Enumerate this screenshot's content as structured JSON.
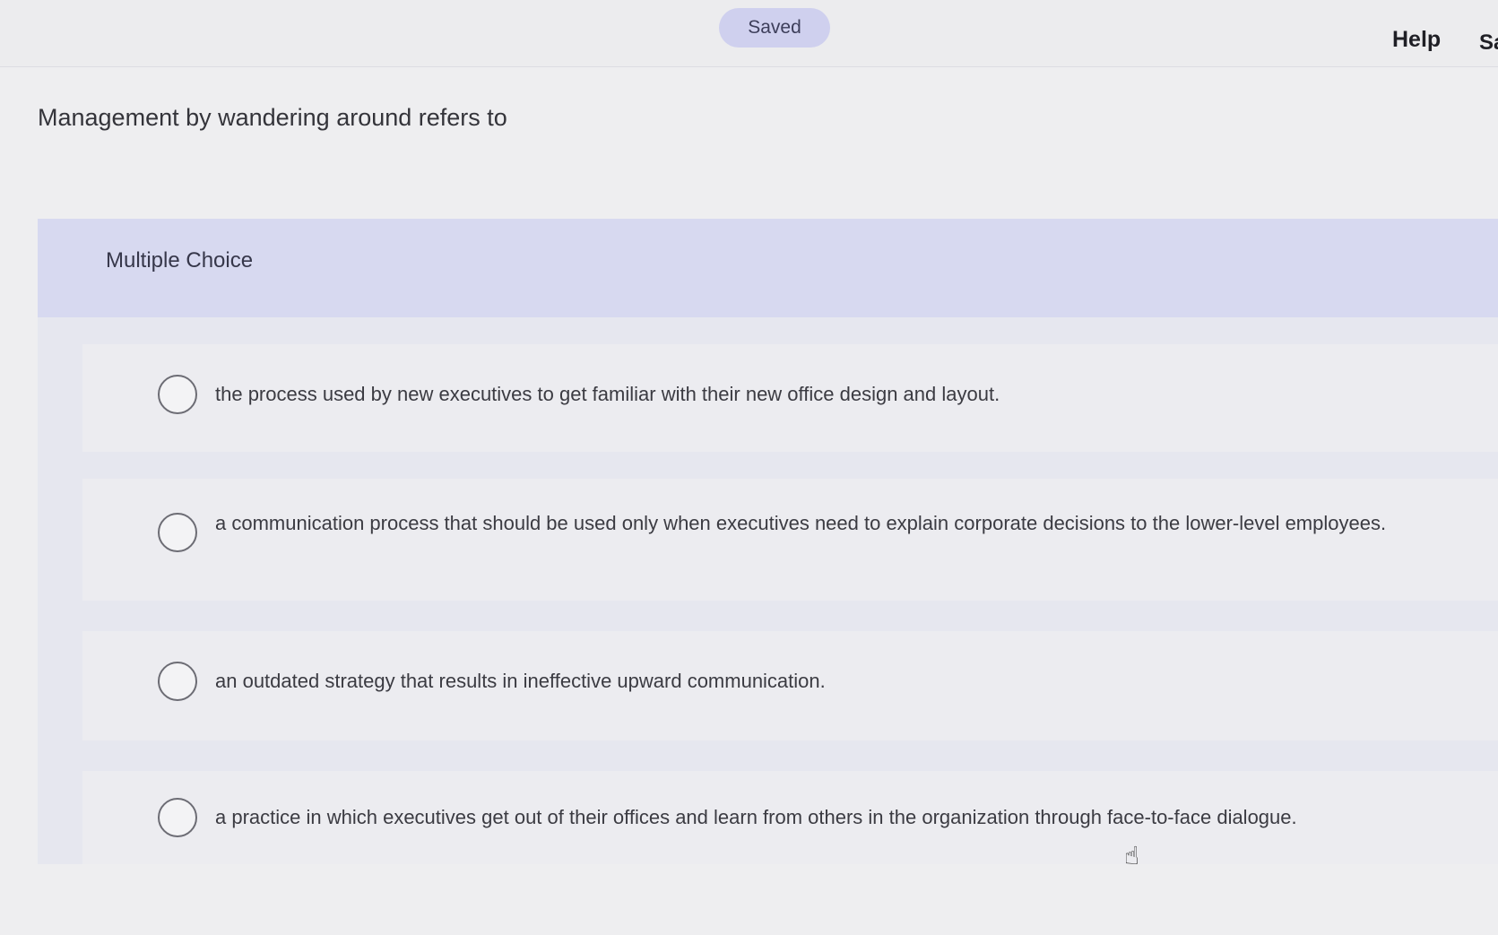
{
  "topbar": {
    "saved_label": "Saved",
    "help_label": "Help",
    "save_label_partial": "Sa"
  },
  "question": {
    "text": "Management by wandering around refers to"
  },
  "multiple_choice": {
    "label": "Multiple Choice",
    "options": [
      {
        "text": "the process used by new executives to get familiar with their new office design and layout."
      },
      {
        "text": "a communication process that should be used only when executives need to explain corporate decisions to the lower-level employees."
      },
      {
        "text": "an outdated strategy that results in ineffective upward communication."
      },
      {
        "text": "a practice in which executives get out of their offices and learn from others in the organization through face-to-face dialogue."
      }
    ]
  },
  "colors": {
    "saved_pill": "#cfd0ee",
    "header_band": "#d7d9f0"
  },
  "icons": {
    "radio": "radio-button-unselected-icon",
    "cursor": "hand-pointer-cursor-icon"
  }
}
